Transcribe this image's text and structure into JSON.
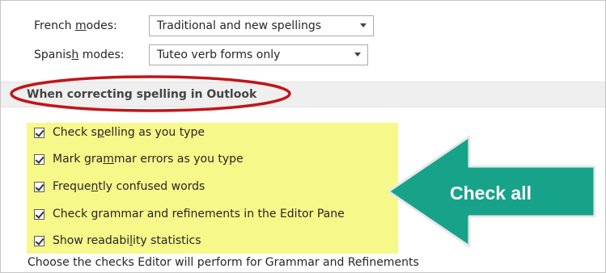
{
  "modes": [
    {
      "label_pre": "French ",
      "label_accel": "m",
      "label_post": "odes:",
      "value": "Traditional and new spellings"
    },
    {
      "label_pre": "Spanis",
      "label_accel": "h",
      "label_post": " modes:",
      "value": "Tuteo verb forms only"
    }
  ],
  "section": {
    "title": "When correcting spelling in Outlook"
  },
  "checks": [
    {
      "pre": "Check s",
      "accel": "p",
      "post": "elling as you type",
      "checked": true
    },
    {
      "pre": "Mark gra",
      "accel": "m",
      "post": "mar errors as you type",
      "checked": true
    },
    {
      "pre": "Freque",
      "accel": "n",
      "post": "tly confused words",
      "checked": true
    },
    {
      "pre": "Check grammar and refinements in the Editor Pane",
      "accel": "",
      "post": "",
      "checked": true
    },
    {
      "pre": "Show readabi",
      "accel": "l",
      "post": "ity statistics",
      "checked": true
    }
  ],
  "footer": {
    "text": "Choose the checks Editor will perform for Grammar and Refinements"
  },
  "callout": {
    "text": "Check all",
    "color": "#17a389"
  },
  "colors": {
    "highlight": "#f7f88a",
    "circle": "#c0151a",
    "section_bg": "#efefef"
  }
}
